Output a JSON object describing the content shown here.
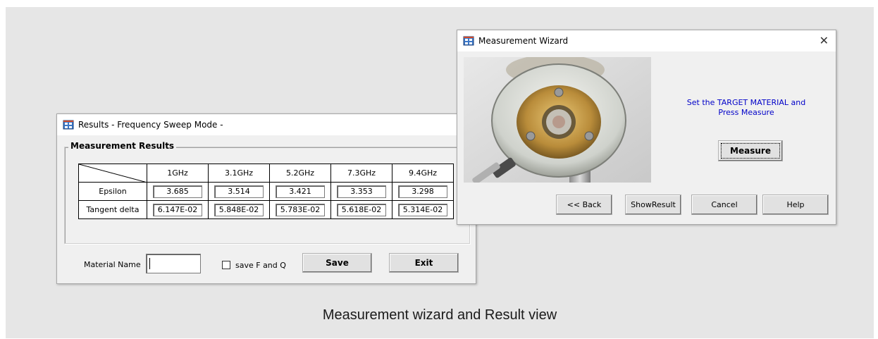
{
  "results_window": {
    "title": "Results - Frequency Sweep Mode -",
    "group_title": "Measurement Results",
    "columns": [
      "1GHz",
      "3.1GHz",
      "5.2GHz",
      "7.3GHz",
      "9.4GHz"
    ],
    "rows": [
      {
        "label": "Epsilon",
        "values": [
          "3.685",
          "3.514",
          "3.421",
          "3.353",
          "3.298"
        ]
      },
      {
        "label": "Tangent delta",
        "values": [
          "6.147E-02",
          "5.848E-02",
          "5.783E-02",
          "5.618E-02",
          "5.314E-02"
        ]
      }
    ],
    "material_name_label": "Material Name",
    "material_name_value": "",
    "save_fq_label": "save F and Q",
    "save_fq_checked": false,
    "save_label": "Save",
    "exit_label": "Exit"
  },
  "wizard_window": {
    "title": "Measurement Wizard",
    "close_glyph": "✕",
    "instruction_line1": "Set the TARGET  MATERIAL  and",
    "instruction_line2": "Press Measure",
    "measure_label": "Measure",
    "back_label": "<< Back",
    "show_result_label": "ShowResult",
    "cancel_label": "Cancel",
    "help_label": "Help"
  },
  "caption": "Measurement wizard and Result view",
  "icons": {
    "app": "app-window-icon",
    "close": "close-icon"
  },
  "colors": {
    "instruction_text": "#0000c8",
    "background": "#e6e6e6",
    "window_face": "#f0f0f0"
  }
}
